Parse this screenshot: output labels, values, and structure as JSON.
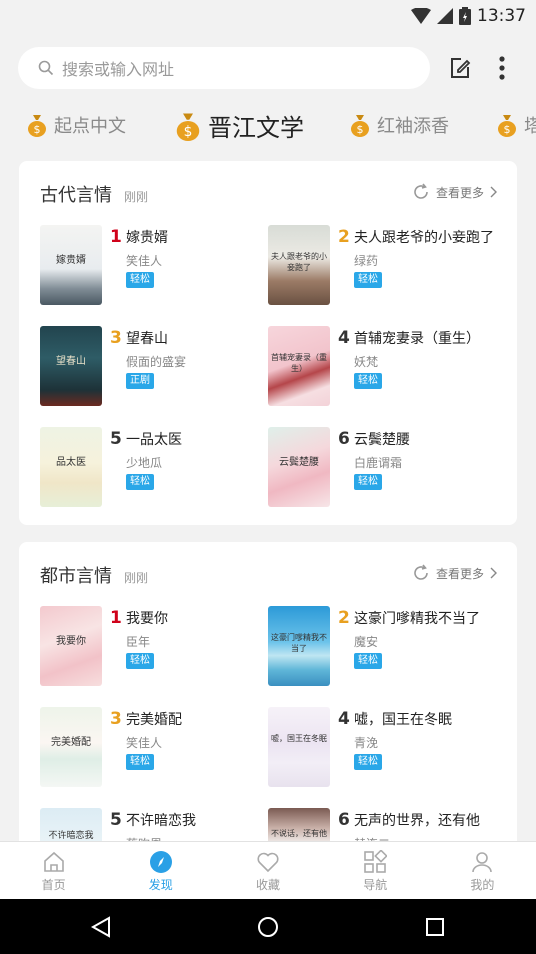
{
  "status": {
    "time": "13:37"
  },
  "search": {
    "placeholder": "搜索或输入网址"
  },
  "channels": [
    {
      "label": "起点中文",
      "active": false
    },
    {
      "label": "晋江文学",
      "active": true
    },
    {
      "label": "红袖添香",
      "active": false
    },
    {
      "label": "塔",
      "active": false
    }
  ],
  "sections": [
    {
      "title": "古代言情",
      "subtitle": "刚刚",
      "more": "查看更多",
      "books": [
        {
          "rank": "1",
          "title": "嫁贵婿",
          "author": "笑佳人",
          "tag": "轻松",
          "cover_text": "嫁贵婿"
        },
        {
          "rank": "2",
          "title": "夫人跟老爷的小妾跑了",
          "author": "绿药",
          "tag": "轻松",
          "cover_text": "夫人跟老爷的小妾跑了"
        },
        {
          "rank": "3",
          "title": "望春山",
          "author": "假面的盛宴",
          "tag": "正剧",
          "cover_text": "望春山"
        },
        {
          "rank": "4",
          "title": "首辅宠妻录（重生）",
          "author": "妖梵",
          "tag": "轻松",
          "cover_text": "首辅宠妻录（重生）"
        },
        {
          "rank": "5",
          "title": "一品太医",
          "author": "少地瓜",
          "tag": "轻松",
          "cover_text": "品太医"
        },
        {
          "rank": "6",
          "title": "云鬓楚腰",
          "author": "白鹿谓霜",
          "tag": "轻松",
          "cover_text": "云鬓楚腰"
        }
      ]
    },
    {
      "title": "都市言情",
      "subtitle": "刚刚",
      "more": "查看更多",
      "books": [
        {
          "rank": "1",
          "title": "我要你",
          "author": "臣年",
          "tag": "轻松",
          "cover_text": "我要你"
        },
        {
          "rank": "2",
          "title": "这豪门嗲精我不当了",
          "author": "魔安",
          "tag": "轻松",
          "cover_text": "这豪门嗲精我不当了"
        },
        {
          "rank": "3",
          "title": "完美婚配",
          "author": "笑佳人",
          "tag": "轻松",
          "cover_text": "完美婚配"
        },
        {
          "rank": "4",
          "title": "嘘，国王在冬眠",
          "author": "青浼",
          "tag": "轻松",
          "cover_text": "嘘，国王在冬眠"
        },
        {
          "rank": "5",
          "title": "不许暗恋我",
          "author": "蔡昀恩",
          "tag": "",
          "cover_text": "不许暗恋我"
        },
        {
          "rank": "6",
          "title": "无声的世界，还有他",
          "author": "赫连二",
          "tag": "",
          "cover_text": "不说话，还有他"
        }
      ]
    }
  ],
  "tabs": [
    {
      "label": "首页",
      "icon": "home-icon",
      "active": false
    },
    {
      "label": "发现",
      "icon": "compass-icon",
      "active": true
    },
    {
      "label": "收藏",
      "icon": "heart-icon",
      "active": false
    },
    {
      "label": "导航",
      "icon": "grid-icon",
      "active": false
    },
    {
      "label": "我的",
      "icon": "person-icon",
      "active": false
    }
  ],
  "colors": {
    "accent": "#2aa0e6",
    "tag_bg": "#2aa7e8",
    "rank_red": "#d0021b",
    "rank_gold": "#e8a020",
    "rank_dark": "#333333"
  }
}
